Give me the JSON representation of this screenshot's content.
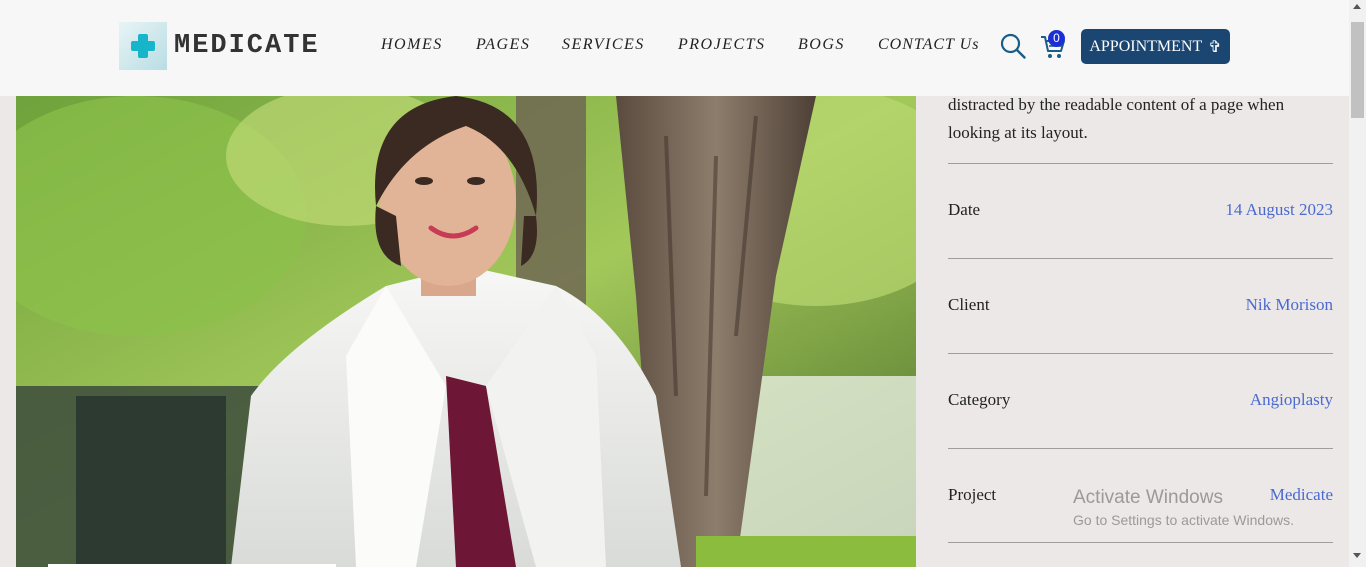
{
  "brand": {
    "name": "MEDICATE"
  },
  "nav": {
    "items": [
      "HOMES",
      "PAGES",
      "SERVICES",
      "PROJECTS",
      "BOGS",
      "CONTACT Us"
    ]
  },
  "cart": {
    "count": "0"
  },
  "appointment": {
    "label": "APPOINTMENT",
    "icon": "plus-cross-icon"
  },
  "content": {
    "description_line1": "distracted by the readable content of a page when",
    "description_line2": "looking at its layout."
  },
  "details": [
    {
      "label": "Date",
      "value": "14 August 2023"
    },
    {
      "label": "Client",
      "value": "Nik Morison"
    },
    {
      "label": "Category",
      "value": "Angioplasty"
    },
    {
      "label": "Project",
      "value": "Medicate"
    }
  ],
  "watermark": {
    "title": "Activate Windows",
    "subtitle": "Go to Settings to activate Windows."
  },
  "colors": {
    "accent": "#1c4672",
    "link": "#4a6ad0",
    "logo": "#17b5c9",
    "badge": "#1c2fd6"
  }
}
